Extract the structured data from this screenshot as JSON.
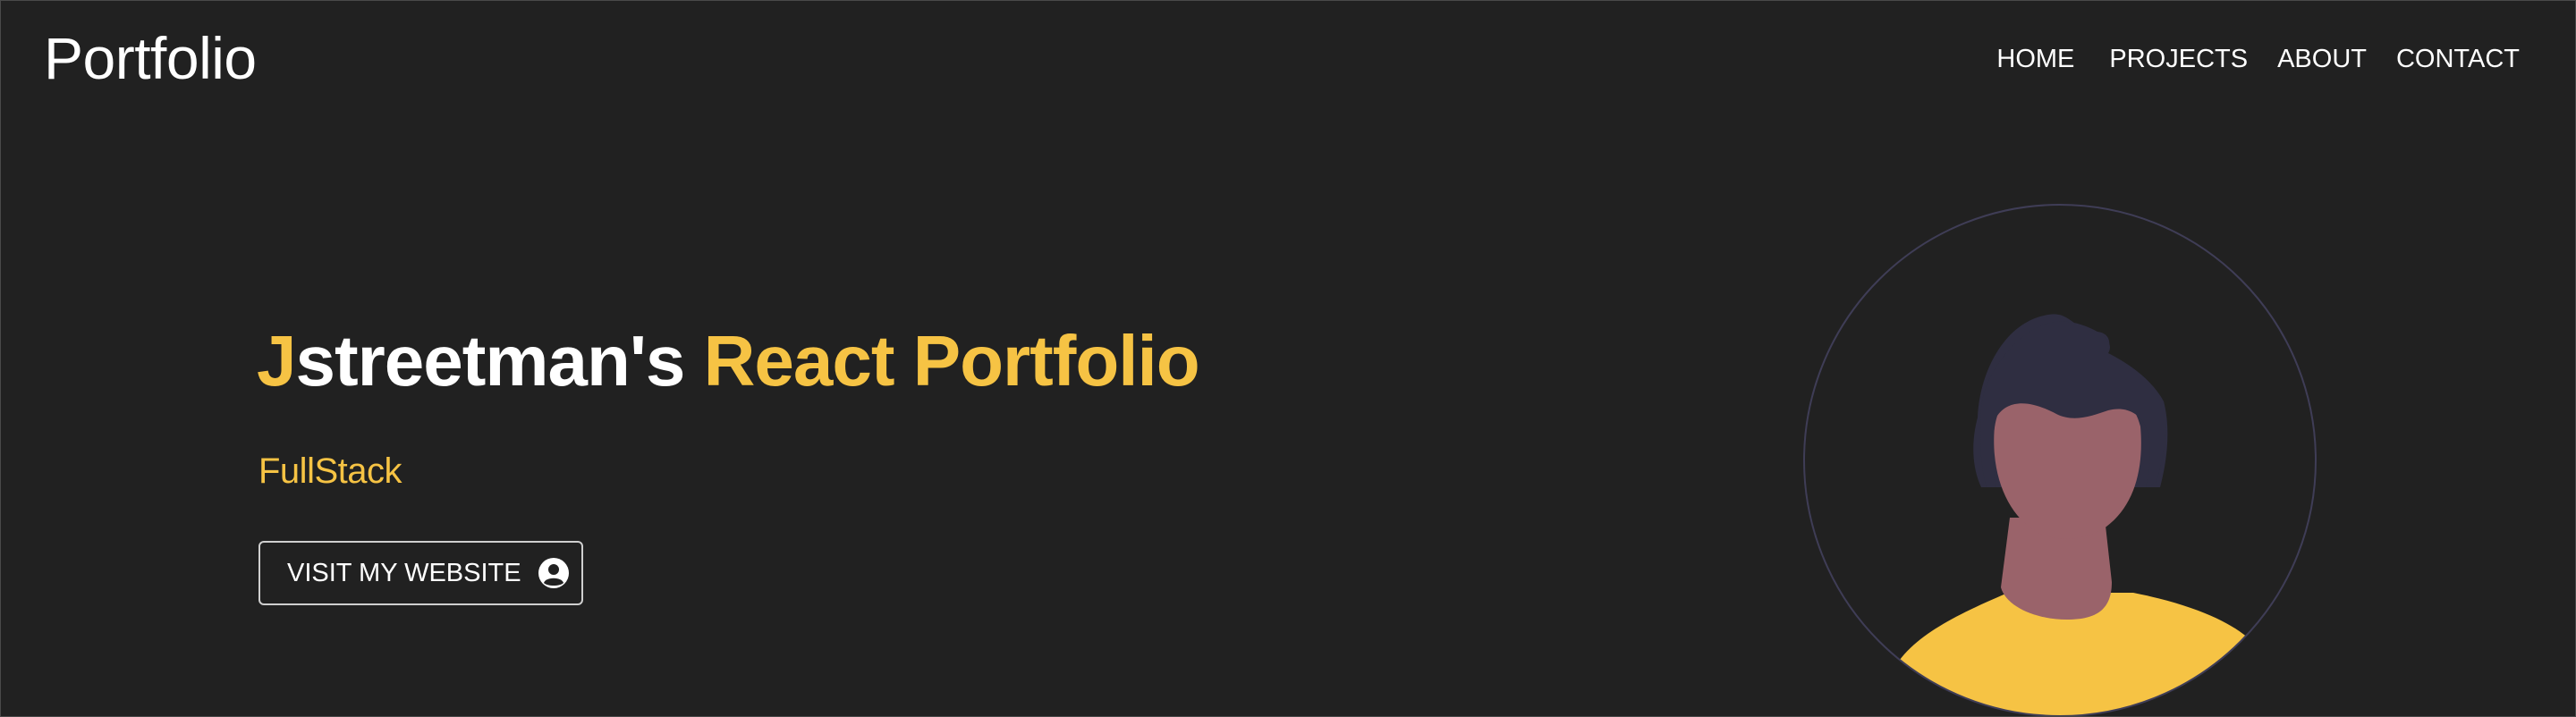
{
  "header": {
    "brand": "Portfolio",
    "nav": {
      "home": "HOME",
      "projects": "PROJECTS",
      "about": "ABOUT",
      "contact": "CONTACT"
    }
  },
  "hero": {
    "title_initial": "J",
    "title_name": "streetman's",
    "title_accent": "React Portfolio",
    "subtitle": "FullStack",
    "cta_label": "VISIT MY WEBSITE",
    "cta_icon": "user-circle-icon"
  },
  "colors": {
    "background": "#212121",
    "accent": "#f6c344",
    "text": "#ffffff",
    "hair": "#2f2e41",
    "skin": "#9a636a",
    "shirt": "#f6c344",
    "circle_outline": "#3f3d56"
  }
}
